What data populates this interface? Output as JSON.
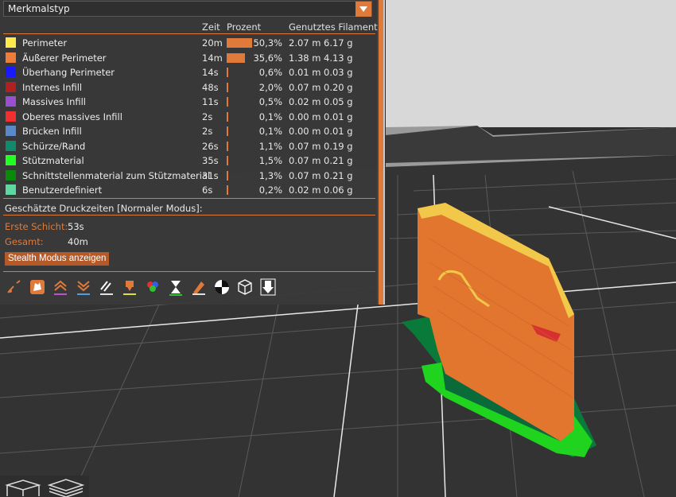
{
  "dropdown": {
    "label": "Merkmalstyp"
  },
  "columns": {
    "zeit": "Zeit",
    "prozent": "Prozent",
    "filament": "Genutztes Filament"
  },
  "features": [
    {
      "name": "Perimeter",
      "time": "20m",
      "pct": "50,3%",
      "pct_value": 50.3,
      "len": "2.07 m",
      "weight": "6.17 g",
      "color": "#ffe94b"
    },
    {
      "name": "Äußerer Perimeter",
      "time": "14m",
      "pct": "35,6%",
      "pct_value": 35.6,
      "len": "1.38 m",
      "weight": "4.13 g",
      "color": "#ee7c3b"
    },
    {
      "name": "Überhang Perimeter",
      "time": "14s",
      "pct": "0,6%",
      "pct_value": 0.6,
      "len": "0.01 m",
      "weight": "0.03 g",
      "color": "#1a1aff"
    },
    {
      "name": "Internes Infill",
      "time": "48s",
      "pct": "2,0%",
      "pct_value": 2.0,
      "len": "0.07 m",
      "weight": "0.20 g",
      "color": "#b02020"
    },
    {
      "name": "Massives Infill",
      "time": "11s",
      "pct": "0,5%",
      "pct_value": 0.5,
      "len": "0.02 m",
      "weight": "0.05 g",
      "color": "#9a4fd0"
    },
    {
      "name": "Oberes massives Infill",
      "time": "2s",
      "pct": "0,1%",
      "pct_value": 0.1,
      "len": "0.00 m",
      "weight": "0.01 g",
      "color": "#f03030"
    },
    {
      "name": "Brücken Infill",
      "time": "2s",
      "pct": "0,1%",
      "pct_value": 0.1,
      "len": "0.00 m",
      "weight": "0.01 g",
      "color": "#5a88c8"
    },
    {
      "name": "Schürze/Rand",
      "time": "26s",
      "pct": "1,1%",
      "pct_value": 1.1,
      "len": "0.07 m",
      "weight": "0.19 g",
      "color": "#0f8a6a"
    },
    {
      "name": "Stützmaterial",
      "time": "35s",
      "pct": "1,5%",
      "pct_value": 1.5,
      "len": "0.07 m",
      "weight": "0.21 g",
      "color": "#22ff22"
    },
    {
      "name": "Schnittstellenmaterial zum Stützmaterial",
      "time": "31s",
      "pct": "1,3%",
      "pct_value": 1.3,
      "len": "0.07 m",
      "weight": "0.21 g",
      "color": "#0a8a0a"
    },
    {
      "name": "Benutzerdefiniert",
      "time": "6s",
      "pct": "0,2%",
      "pct_value": 0.2,
      "len": "0.02 m",
      "weight": "0.06 g",
      "color": "#5ed8a0"
    }
  ],
  "estimate": {
    "title": "Geschätzte Druckzeiten [Normaler Modus]:",
    "first_layer_label": "Erste Schicht:",
    "first_layer_value": "53s",
    "total_label": "Gesamt:",
    "total_value": "40m",
    "stealth_button": "Stealth Modus anzeigen"
  },
  "toolbar_icons": [
    "travel-icon",
    "wipe-icon",
    "retractions-icon",
    "deretractions-icon",
    "seams-icon",
    "tool-changes-icon",
    "color-changes-icon",
    "pause-icon",
    "custom-gcode-icon",
    "center-of-gravity-icon",
    "shells-icon",
    "tool-marker-icon"
  ],
  "accent_color": "#e07a3a"
}
